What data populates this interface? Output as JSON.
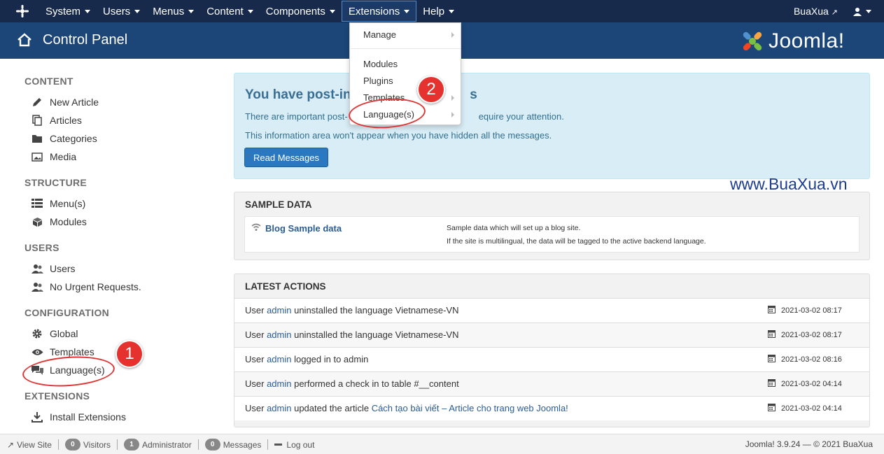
{
  "topnav": {
    "menu": [
      {
        "label": "System"
      },
      {
        "label": "Users"
      },
      {
        "label": "Menus"
      },
      {
        "label": "Content"
      },
      {
        "label": "Components"
      },
      {
        "label": "Extensions"
      },
      {
        "label": "Help"
      }
    ],
    "site_label": "BuaXua"
  },
  "header": {
    "title": "Control Panel",
    "brand": "Joomla!"
  },
  "sidebar": {
    "content_head": "CONTENT",
    "new_article": "New Article",
    "articles": "Articles",
    "categories": "Categories",
    "media": "Media",
    "structure_head": "STRUCTURE",
    "menus": "Menu(s)",
    "modules": "Modules",
    "users_head": "USERS",
    "users": "Users",
    "no_urgent": "No Urgent Requests.",
    "config_head": "CONFIGURATION",
    "global": "Global",
    "templates": "Templates",
    "languages": "Language(s)",
    "extensions_head": "EXTENSIONS",
    "install_ext": "Install Extensions"
  },
  "alert": {
    "title_visible": "You have post-ins",
    "title_end": "s",
    "line1_start": "There are important post-",
    "line1_end": "equire your attention.",
    "line2": "This information area won't appear when you have hidden all the messages.",
    "button": "Read Messages"
  },
  "watermark": "www.BuaXua.vn",
  "sample_data": {
    "title": "SAMPLE DATA",
    "link": "Blog Sample data",
    "desc1": "Sample data which will set up a blog site.",
    "desc2": "If the site is multilingual, the data will be tagged to the active backend language."
  },
  "latest_actions": {
    "title": "LATEST ACTIONS",
    "rows": [
      {
        "prefix": "User ",
        "user": "admin",
        "text": " uninstalled the language Vietnamese-VN",
        "link": "",
        "date": "2021-03-02 08:17"
      },
      {
        "prefix": "User ",
        "user": "admin",
        "text": " uninstalled the language Vietnamese-VN",
        "link": "",
        "date": "2021-03-02 08:17"
      },
      {
        "prefix": "User ",
        "user": "admin",
        "text": " logged in to admin",
        "link": "",
        "date": "2021-03-02 08:16"
      },
      {
        "prefix": "User ",
        "user": "admin",
        "text": " performed a check in to table #__content",
        "link": "",
        "date": "2021-03-02 04:14"
      },
      {
        "prefix": "User ",
        "user": "admin",
        "text": " updated the article ",
        "link": "Cách tạo bài viết – Article cho trang web Joomla!",
        "date": "2021-03-02 04:14"
      }
    ]
  },
  "dropdown": {
    "manage": "Manage",
    "modules": "Modules",
    "plugins": "Plugins",
    "templates": "Templates",
    "languages": "Language(s)"
  },
  "annotations": {
    "badge1": "1",
    "badge2": "2"
  },
  "footer": {
    "view_site": "View Site",
    "visitors_count": "0",
    "visitors": "Visitors",
    "admin_count": "1",
    "administrator": "Administrator",
    "messages_count": "0",
    "messages": "Messages",
    "logout": "Log out",
    "version": "Joomla! 3.9.24 — © 2021 BuaXua"
  },
  "colors": {
    "topnav_bg": "#172a4b",
    "header_bg": "#1b4677",
    "accent_button": "#2a79c0",
    "annotation_red": "#e5322e"
  }
}
